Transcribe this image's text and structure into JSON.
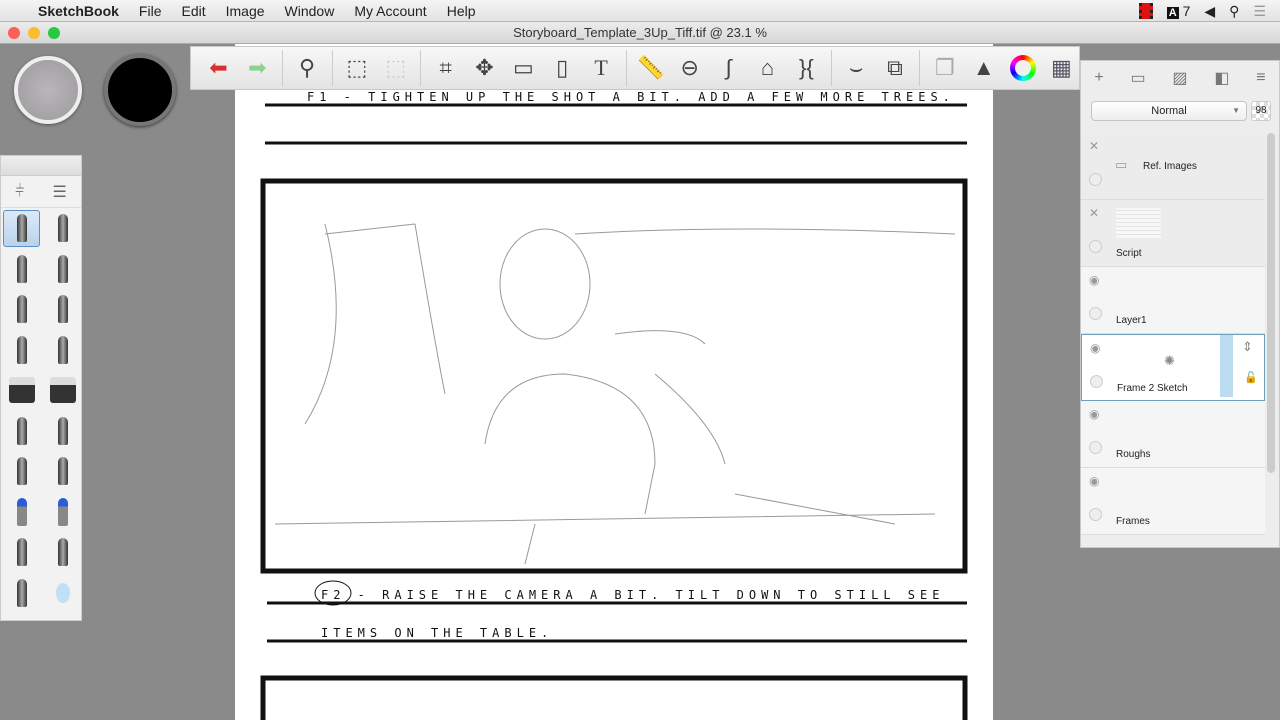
{
  "menubar": {
    "app": "SketchBook",
    "items": [
      "File",
      "Edit",
      "Image",
      "Window",
      "My Account",
      "Help"
    ],
    "adobe_count": "7"
  },
  "window": {
    "title": "Storyboard_Template_3Up_Tiff.tif @ 23.1 %"
  },
  "toolbar": {
    "tools": [
      "undo-icon",
      "redo-icon",
      "zoom-icon",
      "select-icon",
      "clear-selection-icon",
      "crop-icon",
      "transform-icon",
      "distort-icon",
      "fill-icon",
      "text-icon",
      "ruler-icon",
      "ellipse-guide-icon",
      "french-curve-icon",
      "perspective-icon",
      "symmetry-icon",
      "stroke-icon",
      "shape-icon",
      "copy-paste-icon",
      "brush-palette-icon",
      "color-wheel-icon",
      "layout-icon"
    ]
  },
  "page": {
    "caption_f1": "F1 - tighten up the shot a bit.   add a few more trees.",
    "caption_f2": "F2 - raise the camera a bit.  tilt down to still see",
    "caption_f2b": "items on the table."
  },
  "layers": {
    "blend_mode": "Normal",
    "opacity": "98",
    "items": [
      {
        "name": "Ref. Images",
        "visible": false
      },
      {
        "name": "Script",
        "visible": false
      },
      {
        "name": "Layer1",
        "visible": true
      },
      {
        "name": "Frame 2 Sketch",
        "visible": true,
        "selected": true
      },
      {
        "name": "Roughs",
        "visible": true
      },
      {
        "name": "Frames",
        "visible": true
      }
    ]
  },
  "colors": {
    "accent": "#5a8fc8",
    "undo": "#d83030",
    "redo": "#8fd08f"
  }
}
